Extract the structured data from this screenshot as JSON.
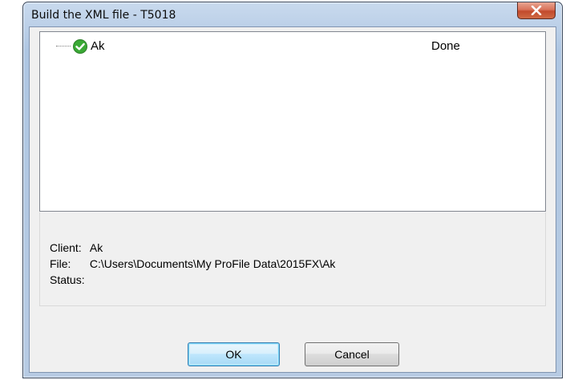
{
  "window": {
    "title": "Build the XML file - T5018"
  },
  "tree": {
    "items": [
      {
        "name": "Ak",
        "status": "Done",
        "icon": "check-icon"
      }
    ]
  },
  "info": {
    "client_label": "Client:",
    "client_value": "Ak",
    "file_label": "File:",
    "file_value": "C:\\Users\\Documents\\My ProFile Data\\2015FX\\Ak",
    "status_label": "Status:",
    "status_value": ""
  },
  "buttons": {
    "ok_label": "OK",
    "cancel_label": "Cancel"
  },
  "colors": {
    "check_green": "#3aa935",
    "close_red": "#c24a2c",
    "title_gradient": "#bcd0e8"
  }
}
